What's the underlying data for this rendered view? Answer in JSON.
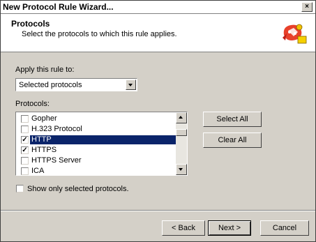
{
  "window": {
    "title": "New Protocol Rule Wizard...",
    "close_label": "×"
  },
  "header": {
    "title": "Protocols",
    "subtitle": "Select the protocols to which this rule applies.",
    "icon": "wizard-protocol-icon"
  },
  "apply": {
    "label": "Apply this rule to:",
    "selected_value": "Selected protocols"
  },
  "protocols": {
    "label": "Protocols:",
    "items": [
      {
        "label": "Gopher",
        "checked": false,
        "selected": false
      },
      {
        "label": "H.323 Protocol",
        "checked": false,
        "selected": false
      },
      {
        "label": "HTTP",
        "checked": true,
        "selected": true
      },
      {
        "label": "HTTPS",
        "checked": true,
        "selected": false
      },
      {
        "label": "HTTPS Server",
        "checked": false,
        "selected": false
      },
      {
        "label": "ICA",
        "checked": false,
        "selected": false
      }
    ]
  },
  "buttons": {
    "select_all": "Select All",
    "clear_all": "Clear All",
    "back": "< Back",
    "next": "Next >",
    "cancel": "Cancel"
  },
  "show_only": {
    "label": "Show only selected protocols.",
    "checked": false
  },
  "colors": {
    "selection": "#0a246a",
    "dialog_bg": "#d4d0c8"
  }
}
